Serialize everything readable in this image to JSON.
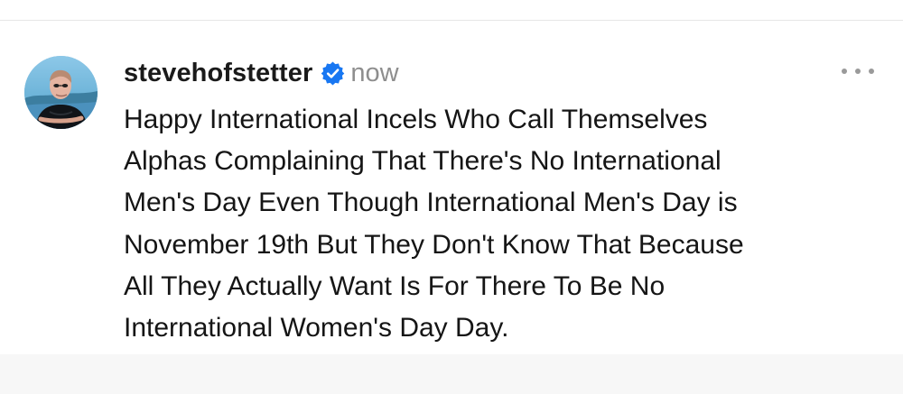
{
  "post": {
    "username": "stevehofstetter",
    "verified_icon": "verified-badge-icon",
    "timestamp": "now",
    "more_icon": "more-options-icon",
    "body_lines": [
      "Happy International Incels Who Call Themselves",
      "Alphas Complaining That There's No International",
      "Men's Day Even Though International Men's Day is",
      "November 19th But They Don't Know That Because",
      "All They Actually Want Is For There To Be No",
      "International Women's Day Day."
    ]
  },
  "colors": {
    "username": "#1a1a1a",
    "timestamp": "#8e8e8e",
    "verified_badge": "#1877f2",
    "more_icon": "#9a9a9a",
    "text": "#151515",
    "bottom_band": "#f7f7f7"
  }
}
